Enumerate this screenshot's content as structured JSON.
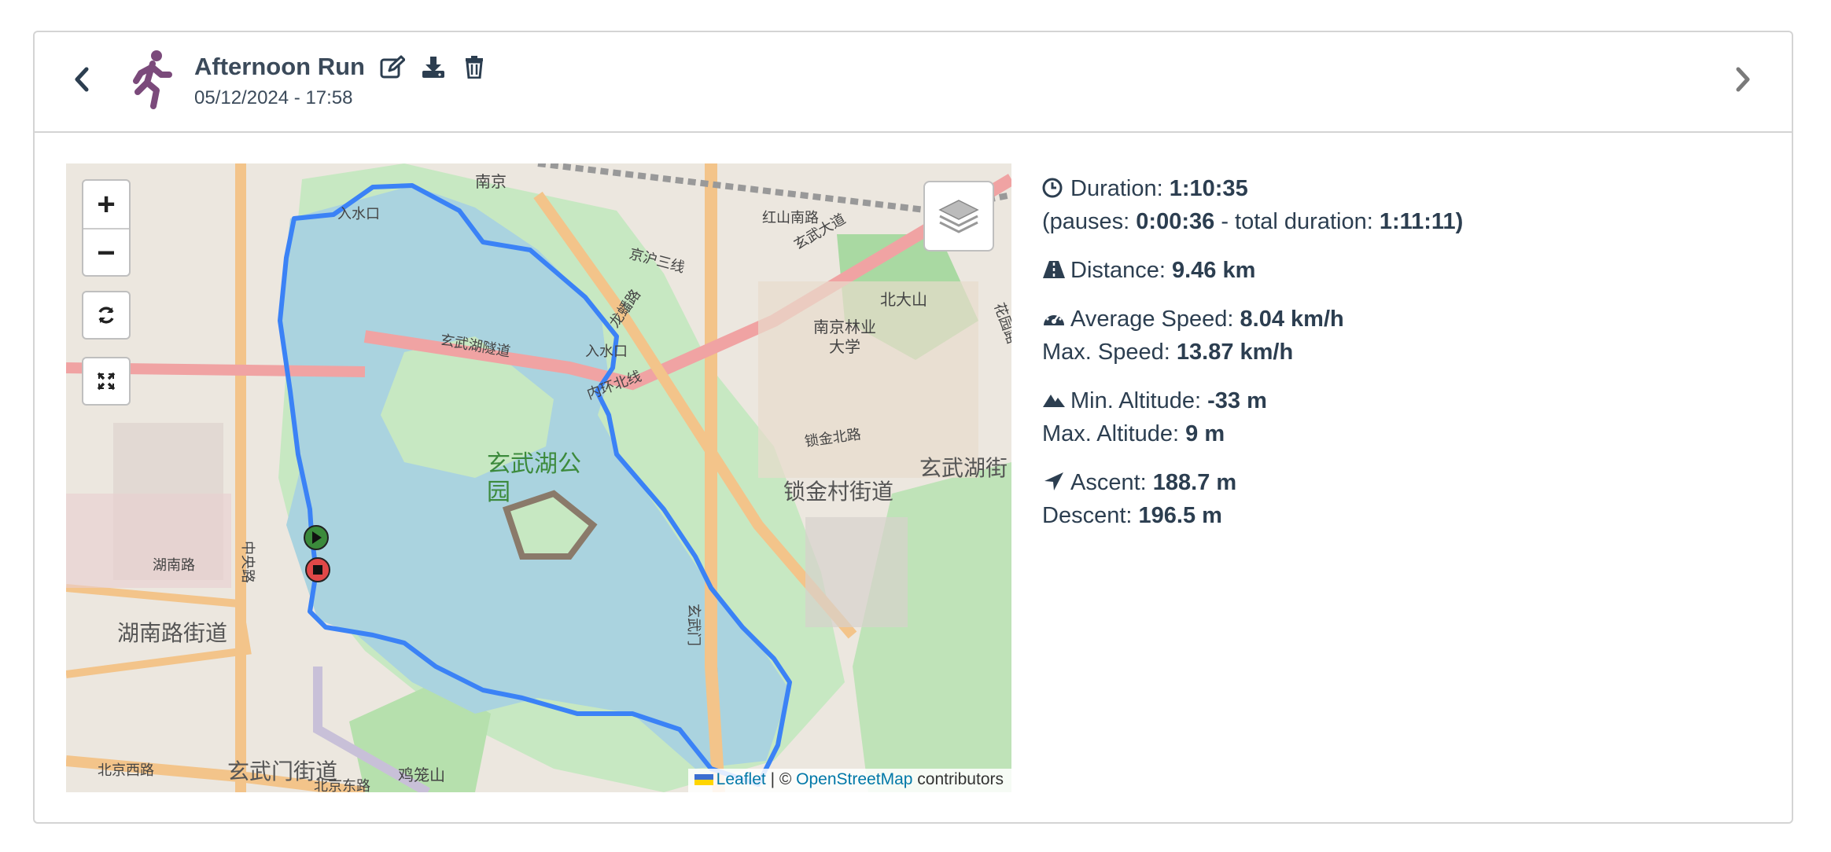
{
  "workout": {
    "title": "Afternoon Run",
    "date": "05/12/2024 - 17:58",
    "sport_icon": "runner-icon",
    "accent": "#7b4a7b"
  },
  "header_actions": [
    {
      "name": "edit",
      "icon": "edit-icon"
    },
    {
      "name": "download",
      "icon": "download-icon"
    },
    {
      "name": "delete",
      "icon": "trash-icon"
    }
  ],
  "map": {
    "zoom_in": "+",
    "zoom_out": "−",
    "attribution": {
      "leaflet": "Leaflet",
      "sep": " | © ",
      "osm": "OpenStreetMap",
      "contributors": " contributors"
    },
    "labels": {
      "park": "玄武湖公园",
      "park_line2": "园",
      "park_line1": "玄武湖公",
      "suojin": "锁金村街道",
      "hunan": "湖南路街道",
      "xuanwumen": "玄武门街道",
      "xuanwuhu": "玄武湖街",
      "forestry_1": "南京林业",
      "forestry_2": "大学",
      "beidashan": "北大山",
      "jimingshan": "鸡笼山",
      "nanjing": "南京",
      "hongshan_rd": "红山南路",
      "xuanwu_ave": "玄武大道",
      "longpan_rd": "龙蟠路",
      "ruishui": "入水口",
      "ruishui2": "入水口",
      "xuanwuhu_tunnel": "玄武湖隧道",
      "neihuan": "内环北线",
      "suojin_n": "锁金北路",
      "zhongyang_rd": "中央路",
      "hunan_rd": "湖南路",
      "beijing_w": "北京西路",
      "beijing_e": "北京东路",
      "jinghu": "京沪三线",
      "xuanwumen_st": "玄武门",
      "huayuan": "花园路"
    },
    "track_color": "#3b82f6"
  },
  "stats": {
    "duration_label": "Duration: ",
    "duration": "1:10:35",
    "pauses_label": "(pauses: ",
    "pauses": "0:00:36",
    "total_label": " - total duration: ",
    "total": "1:11:11)",
    "distance_label": "Distance: ",
    "distance": "9.46 km",
    "avg_speed_label": "Average Speed: ",
    "avg_speed": "8.04 km/h",
    "max_speed_label": "Max. Speed: ",
    "max_speed": "13.87 km/h",
    "min_alt_label": "Min. Altitude: ",
    "min_alt": "-33 m",
    "max_alt_label": "Max. Altitude: ",
    "max_alt": "9 m",
    "ascent_label": "Ascent: ",
    "ascent": "188.7 m",
    "descent_label": "Descent: ",
    "descent": "196.5 m"
  }
}
